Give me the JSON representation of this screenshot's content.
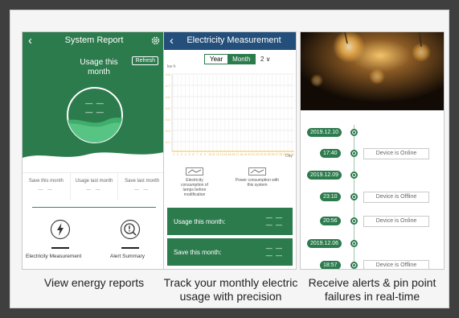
{
  "colors": {
    "brand_green": "#2c7b4d",
    "background": "#3f3f3f"
  },
  "panel1": {
    "title": "System Report",
    "usage_label": "Usage this month",
    "refresh": "Refresh",
    "gauge_top": "— —",
    "gauge_bottom": "— —",
    "stats": [
      {
        "label": "Save this month",
        "value": "— —"
      },
      {
        "label": "Usage last month",
        "value": "— —"
      },
      {
        "label": "Save last month",
        "value": "— —"
      }
    ],
    "btn1": "Electricity Measurement",
    "btn2": "Alert Summary",
    "icons": {
      "back": "back-icon",
      "gear": "gear-icon",
      "lightning": "lightning-icon",
      "alert": "alert-icon"
    }
  },
  "panel2": {
    "title": "Electricity Measurement",
    "tab_year": "Year",
    "tab_month": "Month",
    "dropdown": "2",
    "unit": "kw·h",
    "xaxis": "Day",
    "legend1": "Electricity consumption of lamps before modification",
    "legend2": "Power consumption with this system",
    "usage_label": "Usage this month:",
    "usage_value": "— —",
    "usage_sub": "— —",
    "save_label": "Save this month:",
    "save_value": "— —",
    "save_sub": "— —"
  },
  "panel3": {
    "events": [
      {
        "date": "2019.12.10"
      },
      {
        "time": "17:40",
        "status": "Device is Online"
      },
      {
        "date": "2019.12.09"
      },
      {
        "time": "23:10",
        "status": "Device is Offline"
      },
      {
        "time": "20:56",
        "status": "Device is Online"
      },
      {
        "date": "2019.12.06"
      },
      {
        "time": "18:57",
        "status": "Device is Offline"
      }
    ]
  },
  "captions": {
    "c1": "View energy reports",
    "c2_l1": "Track your monthly electric",
    "c2_l2": "usage with precision",
    "c3_l1": "Receive alerts & pin point",
    "c3_l2": "failures in real-time"
  }
}
